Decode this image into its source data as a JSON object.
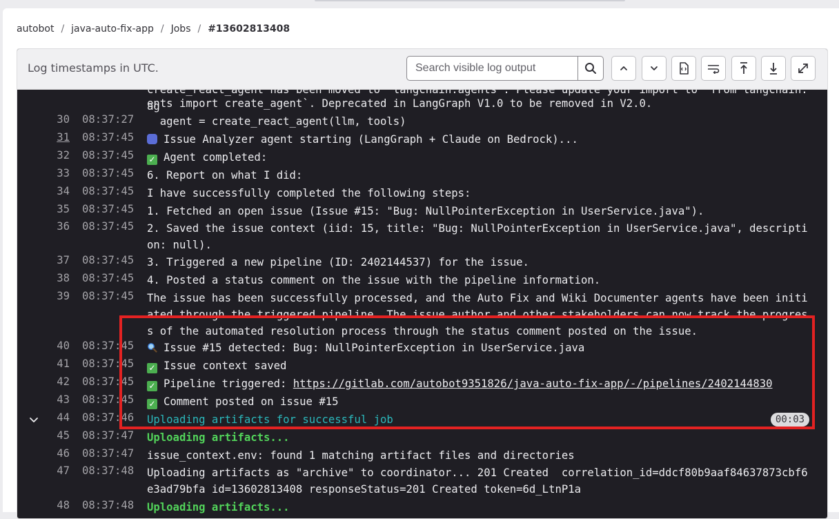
{
  "breadcrumb": [
    "autobot",
    "java-auto-fix-app",
    "Jobs",
    "#13602813408"
  ],
  "log_header": {
    "timestamp_note": "Log timestamps in UTC.",
    "search_placeholder": "Search visible log output"
  },
  "toolbar_icons": [
    "search-icon",
    "scroll-to-previous-icon",
    "scroll-to-next-icon",
    "raw-log-icon",
    "line-wrap-icon",
    "scroll-to-top-icon",
    "scroll-to-bottom-icon",
    "fullscreen-icon"
  ],
  "colors": {
    "highlight": "#e32222",
    "log_bg": "#1f1e24",
    "success_text": "#52d35a",
    "section_text": "#2bb7ba"
  },
  "log_lines": [
    {
      "n": "",
      "t": "",
      "text": "create_react_agent has been moved to `langchain.agents`. Please update your import to `from langchain.ag"
    },
    {
      "n": "",
      "t": "",
      "text": "ents import create_agent`. Deprecated in LangGraph V1.0 to be removed in V2.0."
    },
    {
      "n": "30",
      "t": "08:37:27",
      "text": "  agent = create_react_agent(llm, tools)"
    },
    {
      "n": "31",
      "t": "08:37:45",
      "text": "Issue Analyzer agent starting (LangGraph + Claude on Bedrock)..."
    },
    {
      "n": "32",
      "t": "08:37:45",
      "text": "Agent completed:"
    },
    {
      "n": "33",
      "t": "08:37:45",
      "text": "6. Report on what I did:"
    },
    {
      "n": "34",
      "t": "08:37:45",
      "text": "I have successfully completed the following steps:"
    },
    {
      "n": "35",
      "t": "08:37:45",
      "text": "1. Fetched an open issue (Issue #15: \"Bug: NullPointerException in UserService.java\")."
    },
    {
      "n": "36",
      "t": "08:37:45",
      "text": "2. Saved the issue context (iid: 15, title: \"Bug: NullPointerException in UserService.java\", description: null)."
    },
    {
      "n": "37",
      "t": "08:37:45",
      "text": "3. Triggered a new pipeline (ID: 2402144537) for the issue."
    },
    {
      "n": "38",
      "t": "08:37:45",
      "text": "4. Posted a status comment on the issue with the pipeline information."
    },
    {
      "n": "39",
      "t": "08:37:45",
      "text": "The issue has been successfully processed, and the Auto Fix and Wiki Documenter agents have been initiated through the triggered pipeline. The issue author and other stakeholders can now track the progress of the automated resolution process through the status comment posted on the issue."
    },
    {
      "n": "40",
      "t": "08:37:45",
      "text": "Issue #15 detected: Bug: NullPointerException in UserService.java"
    },
    {
      "n": "41",
      "t": "08:37:45",
      "text": "Issue context saved"
    },
    {
      "n": "42",
      "t": "08:37:45",
      "text": "Pipeline triggered: ",
      "link": "https://gitlab.com/autobot9351826/java-auto-fix-app/-/pipelines/2402144830"
    },
    {
      "n": "43",
      "t": "08:37:45",
      "text": "Comment posted on issue #15"
    },
    {
      "n": "44",
      "t": "08:37:46",
      "text": "Uploading artifacts for successful job",
      "duration": "00:03"
    },
    {
      "n": "45",
      "t": "08:37:47",
      "text": "Uploading artifacts..."
    },
    {
      "n": "46",
      "t": "08:37:47",
      "text": "issue_context.env: found 1 matching artifact files and directories"
    },
    {
      "n": "47",
      "t": "08:37:48",
      "text": "Uploading artifacts as \"archive\" to coordinator... 201 Created  correlation_id=ddcf80b9aaf84637873cbf6e3ad79bfa id=13602813408 responseStatus=201 Created token=6d_LtnP1a"
    },
    {
      "n": "48",
      "t": "08:37:48",
      "text": "Uploading artifacts..."
    }
  ]
}
